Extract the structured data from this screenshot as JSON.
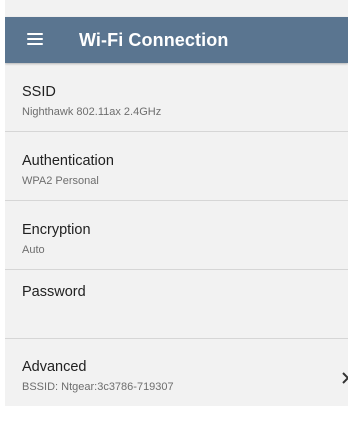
{
  "app_bar": {
    "title": "Wi-Fi Connection",
    "menu_icon": "hamburger-menu-icon",
    "background": "#5a7590"
  },
  "settings": {
    "ssid": {
      "label": "SSID",
      "value": "Nighthawk 802.11ax 2.4GHz"
    },
    "authentication": {
      "label": "Authentication",
      "value": "WPA2 Personal"
    },
    "encryption": {
      "label": "Encryption",
      "value": "Auto"
    },
    "password": {
      "label": "Password"
    },
    "advanced": {
      "label": "Advanced",
      "value": "BSSID:  Ntgear:3c3786-719307",
      "icon": "chevron-right-icon"
    }
  }
}
